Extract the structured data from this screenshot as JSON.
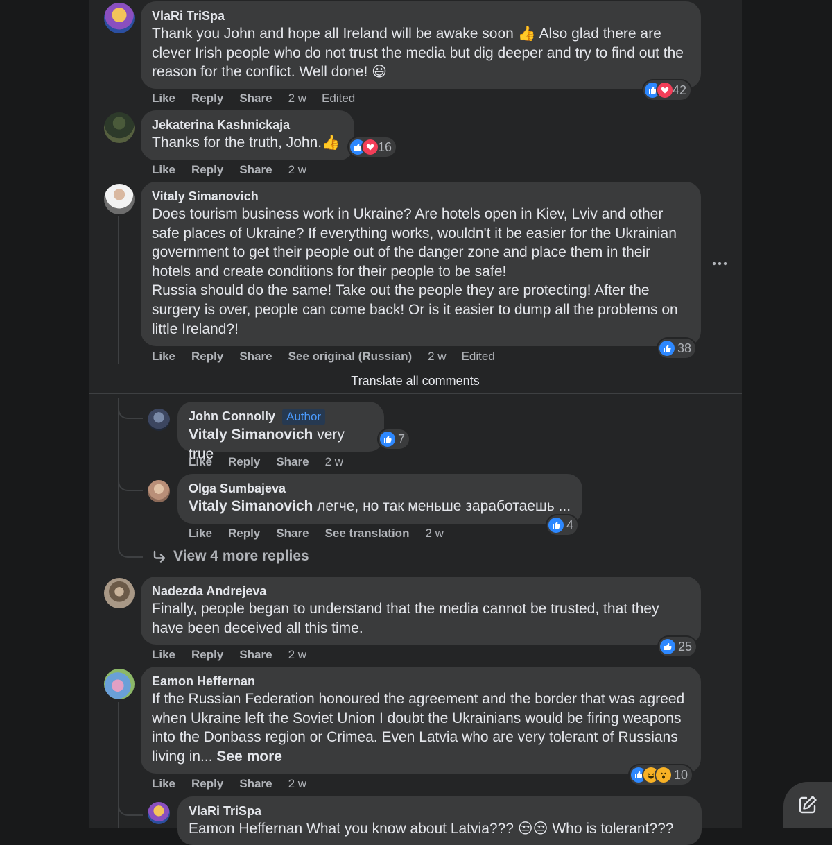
{
  "comments": [
    {
      "author": "VlaRi TriSpa",
      "text": "Thank you John and hope all Ireland will be awake soon 👍 Also glad there are clever Irish people who do not trust the media but dig deeper and try to find out the reason for the conflict. Well done! 😃",
      "actions": [
        "Like",
        "Reply",
        "Share"
      ],
      "time": "2 w",
      "edited": "Edited",
      "reactions": 42
    },
    {
      "author": "Jekaterina Kashnickaja",
      "text": "Thanks for the truth, John.👍",
      "actions": [
        "Like",
        "Reply",
        "Share"
      ],
      "time": "2 w",
      "reactions": 16
    },
    {
      "author": "Vitaly Simanovich",
      "text": "Does tourism business work in Ukraine? Are hotels open in Kiev, Lviv and other safe places of Ukraine? If everything works, wouldn't it be easier for the Ukrainian government to get their people out of the danger zone and place them in their hotels and create conditions for their people to be safe!\nRussia should do the same! Take out the people they are protecting! After the surgery is over, people can come back! Or is it easier to dump all the problems on little Ireland?!",
      "actions": [
        "Like",
        "Reply",
        "Share"
      ],
      "see_original": "See original (Russian)",
      "time": "2 w",
      "edited": "Edited",
      "reactions": 38
    }
  ],
  "translate_all": "Translate all comments",
  "replies": [
    {
      "author": "John Connolly",
      "badge": "Author",
      "mention": "Vitaly Simanovich",
      "text": " very true",
      "actions": [
        "Like",
        "Reply",
        "Share"
      ],
      "time": "2 w",
      "reactions": 7
    },
    {
      "author": "Olga Sumbajeva",
      "mention": "Vitaly Simanovich",
      "text": " легче, но так меньше заработаешь ...",
      "actions": [
        "Like",
        "Reply",
        "Share"
      ],
      "see_translation": "See translation",
      "time": "2 w",
      "reactions": 4
    }
  ],
  "view_more": "View 4 more replies",
  "more_comments": [
    {
      "author": "Nadezda Andrejeva",
      "text": "Finally, people began to understand that the media cannot be trusted, that they have been deceived all this time.",
      "actions": [
        "Like",
        "Reply",
        "Share"
      ],
      "time": "2 w",
      "reactions": 25
    },
    {
      "author": "Eamon Heffernan",
      "text": "If the Russian Federation honoured the agreement and the border that was agreed when Ukraine left the Soviet Union I doubt the Ukrainians would be firing weapons into the Donbass region or Crimea. Even Latvia who are very tolerant of Russians living in... ",
      "see_more": "See more",
      "actions": [
        "Like",
        "Reply",
        "Share"
      ],
      "time": "2 w",
      "reactions": 10
    }
  ],
  "last_reply": {
    "author": "VlaRi TriSpa",
    "text": "Eamon Heffernan What you know about Latvia??? 😒😒 Who is tolerant???"
  },
  "colors": {
    "like": "#2d88ff",
    "love": "#f33e58",
    "bubble": "#3a3b3c",
    "feed": "#242526",
    "background": "#18191a"
  },
  "icons": {
    "more": "more-horizontal-icon",
    "compose": "compose-edit-icon",
    "reply_arrow": "reply-arrow-icon"
  }
}
